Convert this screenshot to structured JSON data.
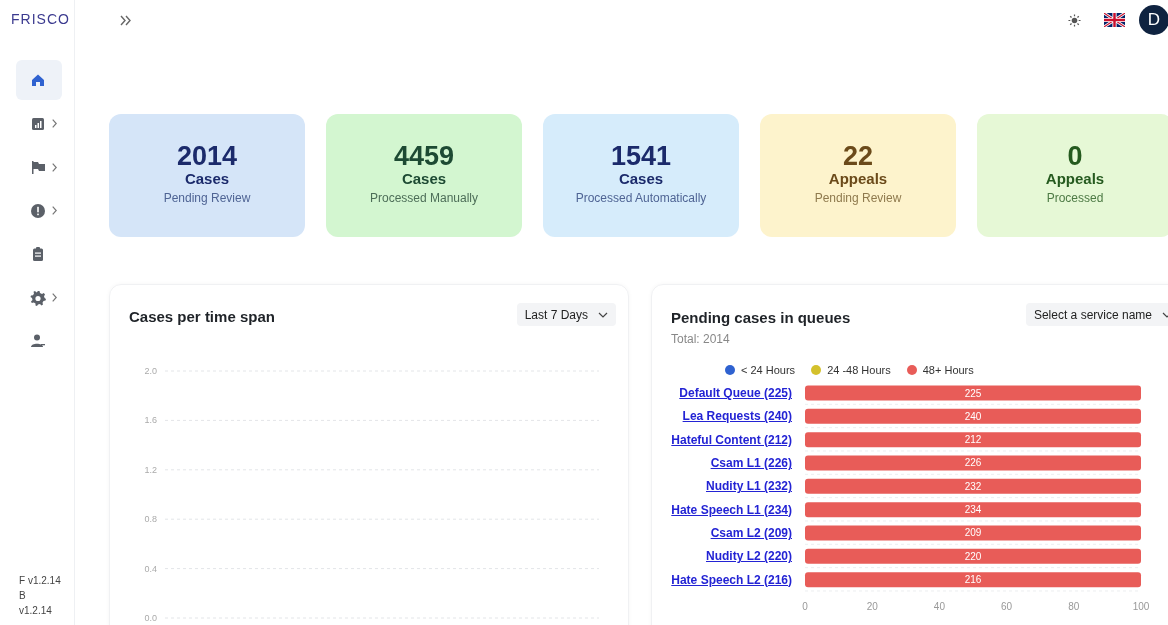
{
  "sidebar": {
    "logo": "FRISCO",
    "items": [
      {
        "kind": "home",
        "selected": true,
        "expandable": false
      },
      {
        "kind": "report",
        "selected": false,
        "expandable": true
      },
      {
        "kind": "flag",
        "selected": false,
        "expandable": true
      },
      {
        "kind": "alert",
        "selected": false,
        "expandable": true
      },
      {
        "kind": "clipboard",
        "selected": false,
        "expandable": false
      },
      {
        "kind": "settings",
        "selected": false,
        "expandable": true
      },
      {
        "kind": "user",
        "selected": false,
        "expandable": false
      }
    ],
    "version": [
      "F v1.2.14",
      "B",
      "v1.2.14"
    ]
  },
  "header": {
    "avatar": "D"
  },
  "cards": [
    {
      "value": "2014",
      "unit": "Cases",
      "label": "Pending Review",
      "kind": "pending"
    },
    {
      "value": "4459",
      "unit": "Cases",
      "label": "Processed Manually",
      "kind": "manual"
    },
    {
      "value": "1541",
      "unit": "Cases",
      "label": "Processed Automatically",
      "kind": "automatic"
    },
    {
      "value": "22",
      "unit": "Appeals",
      "label": "Pending Review",
      "kind": "appeal"
    },
    {
      "value": "0",
      "unit": "Appeals",
      "label": "Processed",
      "kind": "resolved"
    }
  ],
  "time_chart": {
    "title": "Cases per time span",
    "dropdown": "Last 7 Days",
    "axis_labels": [
      "2.0",
      "1.6",
      "1.2",
      "0.8",
      "0.4",
      "0.0"
    ]
  },
  "queues": {
    "title": "Pending cases in queues",
    "total": "Total: 2014",
    "dropdown": "Select a service name",
    "legend": [
      {
        "label": "< 24 Hours",
        "color": "#2f62d0"
      },
      {
        "label": "24 -48 Hours",
        "color": "#d4c12c"
      },
      {
        "label": "48+ Hours",
        "color": "#e85c58"
      }
    ],
    "rows": [
      {
        "label": "Default Queue (225)",
        "value": "225",
        "color": "#e85c58"
      },
      {
        "label": "Lea Requests (240)",
        "value": "240",
        "color": "#e85c58"
      },
      {
        "label": "Hateful Content (212)",
        "value": "212",
        "color": "#e85c58"
      },
      {
        "label": "Csam L1 (226)",
        "value": "226",
        "color": "#e85c58"
      },
      {
        "label": "Nudity L1 (232)",
        "value": "232",
        "color": "#e85c58"
      },
      {
        "label": "Hate Speech L1 (234)",
        "value": "234",
        "color": "#e85c58"
      },
      {
        "label": "Csam L2 (209)",
        "value": "209",
        "color": "#e85c58"
      },
      {
        "label": "Nudity L2 (220)",
        "value": "220",
        "color": "#e85c58"
      },
      {
        "label": "Hate Speech L2 (216)",
        "value": "216",
        "color": "#e85c58"
      }
    ],
    "axis_labels": [
      "0",
      "20",
      "40",
      "60",
      "80",
      "100"
    ]
  }
}
